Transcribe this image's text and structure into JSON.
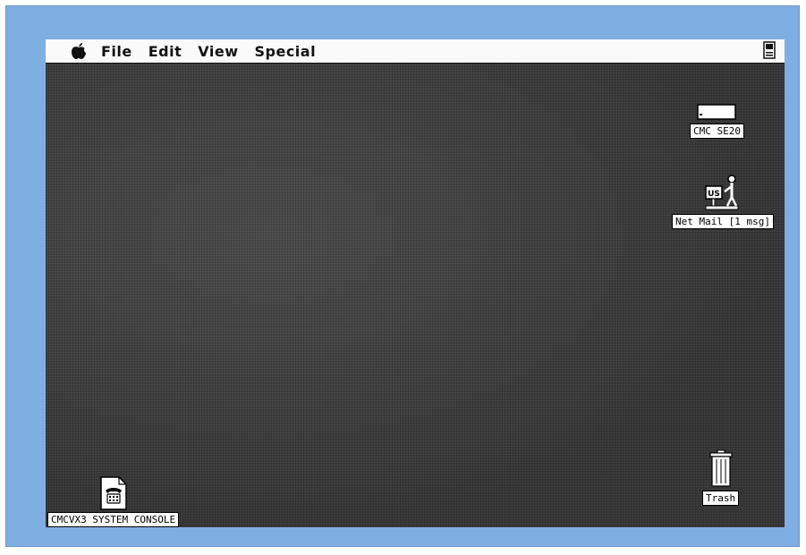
{
  "menubar": {
    "items": [
      "File",
      "Edit",
      "View",
      "Special"
    ]
  },
  "desktop": {
    "icons": {
      "disk": "CMC SE20",
      "mail": "Net Mail [1 msg]",
      "console": "CMCVX3 SYSTEM CONSOLE",
      "trash": "Trash"
    },
    "mail_sign": "US"
  }
}
